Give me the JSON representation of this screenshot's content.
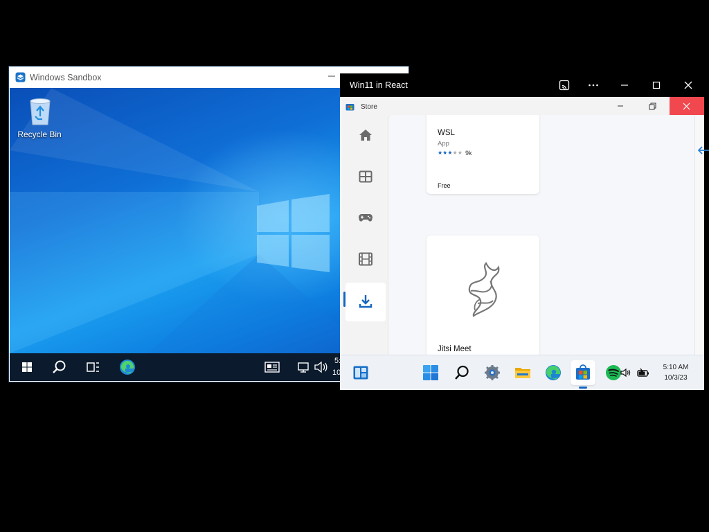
{
  "sandbox": {
    "title": "Windows Sandbox",
    "desktop_icons": [
      {
        "label": "Recycle Bin",
        "icon": "recycle-bin-icon"
      }
    ],
    "taskbar": {
      "items": [
        "start-icon",
        "search-icon",
        "task-view-icon",
        "edge-icon"
      ],
      "tray": [
        "news-icon",
        "network-icon",
        "volume-icon"
      ],
      "clock_partial": "5:",
      "date_partial": "10"
    }
  },
  "win11": {
    "title": "Win11 in React",
    "controls": [
      "cast-icon",
      "more-icon",
      "minimize-icon",
      "maximize-icon",
      "close-icon"
    ],
    "store": {
      "title": "Store",
      "nav": [
        {
          "name": "home",
          "icon": "home-icon"
        },
        {
          "name": "apps",
          "icon": "apps-icon"
        },
        {
          "name": "gaming",
          "icon": "gamepad-icon"
        },
        {
          "name": "movies",
          "icon": "film-icon"
        },
        {
          "name": "downloads",
          "icon": "download-icon",
          "active": true
        }
      ],
      "cards": [
        {
          "name": "WSL",
          "category": "App",
          "rating": 3,
          "rating_max": 5,
          "reviews": "9k",
          "price": "Free"
        },
        {
          "name": "Jitsi Meet"
        }
      ],
      "accent": "#1464c0",
      "close_color": "#f0484e"
    },
    "taskbar": {
      "items": [
        "widgets-icon",
        "start-icon",
        "search-icon",
        "settings-icon",
        "file-explorer-icon",
        "edge-icon",
        "store-icon",
        "spotify-icon"
      ],
      "active": "store-icon",
      "tray": [
        "volume-icon",
        "battery-icon"
      ],
      "time": "5:10 AM",
      "date": "10/3/23"
    }
  }
}
